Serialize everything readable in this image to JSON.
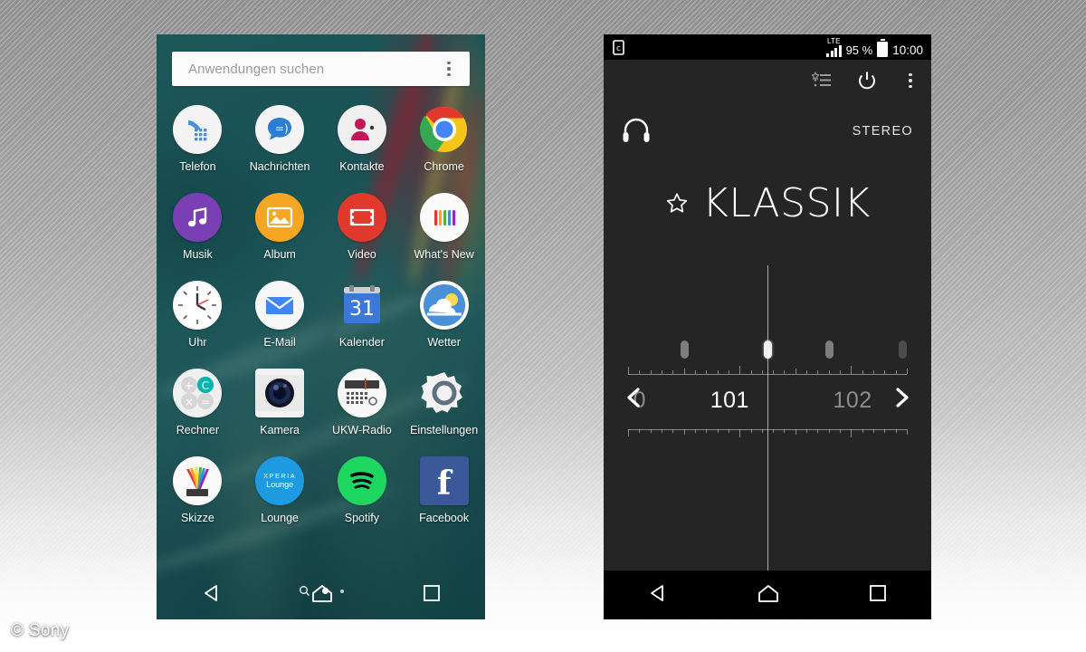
{
  "watermark": "© Sony",
  "phone_left": {
    "name": "app-drawer-screen",
    "search": {
      "placeholder": "Anwendungen suchen",
      "overflow_icon": "kebab-menu-icon"
    },
    "apps": [
      [
        {
          "label": "Telefon",
          "icon": "phone-icon"
        },
        {
          "label": "Nachrichten",
          "icon": "messages-icon"
        },
        {
          "label": "Kontakte",
          "icon": "contacts-icon"
        },
        {
          "label": "Chrome",
          "icon": "chrome-icon"
        }
      ],
      [
        {
          "label": "Musik",
          "icon": "music-note-icon"
        },
        {
          "label": "Album",
          "icon": "photo-album-icon"
        },
        {
          "label": "Video",
          "icon": "video-film-icon"
        },
        {
          "label": "What's New",
          "icon": "whats-new-icon"
        }
      ],
      [
        {
          "label": "Uhr",
          "icon": "clock-icon"
        },
        {
          "label": "E-Mail",
          "icon": "email-envelope-icon"
        },
        {
          "label": "Kalender",
          "icon": "calendar-icon",
          "day": "31"
        },
        {
          "label": "Wetter",
          "icon": "weather-sun-cloud-icon"
        }
      ],
      [
        {
          "label": "Rechner",
          "icon": "calculator-icon"
        },
        {
          "label": "Kamera",
          "icon": "camera-lens-icon"
        },
        {
          "label": "UKW-Radio",
          "icon": "fm-radio-icon"
        },
        {
          "label": "Einstellungen",
          "icon": "gear-icon"
        }
      ],
      [
        {
          "label": "Skizze",
          "icon": "sketch-icon"
        },
        {
          "label": "Lounge",
          "icon": "xperia-lounge-icon",
          "line1": "XPERIA",
          "line2": "Lounge"
        },
        {
          "label": "Spotify",
          "icon": "spotify-icon"
        },
        {
          "label": "Facebook",
          "icon": "facebook-icon",
          "glyph": "f"
        }
      ]
    ],
    "page_indicator": {
      "search_icon": "search-icon",
      "dots": 2,
      "active_index": 0
    },
    "navbar": {
      "back": "back-nav-icon",
      "home": "home-nav-icon",
      "recents": "recents-nav-icon"
    }
  },
  "phone_right": {
    "name": "fm-radio-screen",
    "statusbar": {
      "notification_icon": "sync-notification-icon",
      "network": "LTE",
      "battery_percent": "95 %",
      "battery_icon": "battery-full-icon",
      "time": "10:00"
    },
    "toolbar": [
      {
        "icon": "favorites-list-icon",
        "name": "favourites-button"
      },
      {
        "icon": "power-icon",
        "name": "power-button"
      },
      {
        "icon": "kebab-menu-icon",
        "name": "overflow-menu-button"
      }
    ],
    "output": {
      "headphone_icon": "headphones-icon",
      "mode": "STEREO"
    },
    "station": {
      "favorite_icon": "star-outline-icon",
      "name": "KLASSIK"
    },
    "dial": {
      "prev_icon": "chevron-left-icon",
      "next_icon": "chevron-right-icon",
      "labels": [
        {
          "text": "0",
          "x_pct": 11,
          "active": false
        },
        {
          "text": "101",
          "x_pct": 38.5,
          "active": true
        },
        {
          "text": "102",
          "x_pct": 76,
          "active": false
        }
      ],
      "markers": [
        {
          "x_pct": 25.5,
          "tuned": false
        },
        {
          "x_pct": 50.0,
          "tuned": true
        },
        {
          "x_pct": 68.8,
          "tuned": false
        },
        {
          "x_pct": 91.0,
          "tuned": false
        }
      ]
    },
    "navbar": {
      "back": "back-nav-icon",
      "home": "home-nav-icon",
      "recents": "recents-nav-icon"
    }
  },
  "colors": {
    "wallpaper_teal": "#1d5657",
    "radio_bg": "#252525",
    "statusbar_bg": "#000000",
    "accent_white": "#ffffff",
    "phone_blue": "#4a90d9",
    "messages_blue": "#2a7fd4",
    "contacts_pink": "#c2185b",
    "music_purple": "#7b3fb5",
    "album_orange": "#f5a623",
    "video_red": "#e1392d",
    "calendar_blue": "#3b78d8",
    "spotify_green": "#1ed760",
    "facebook_blue": "#3b5998",
    "lounge_blue": "#1e9ae0"
  }
}
